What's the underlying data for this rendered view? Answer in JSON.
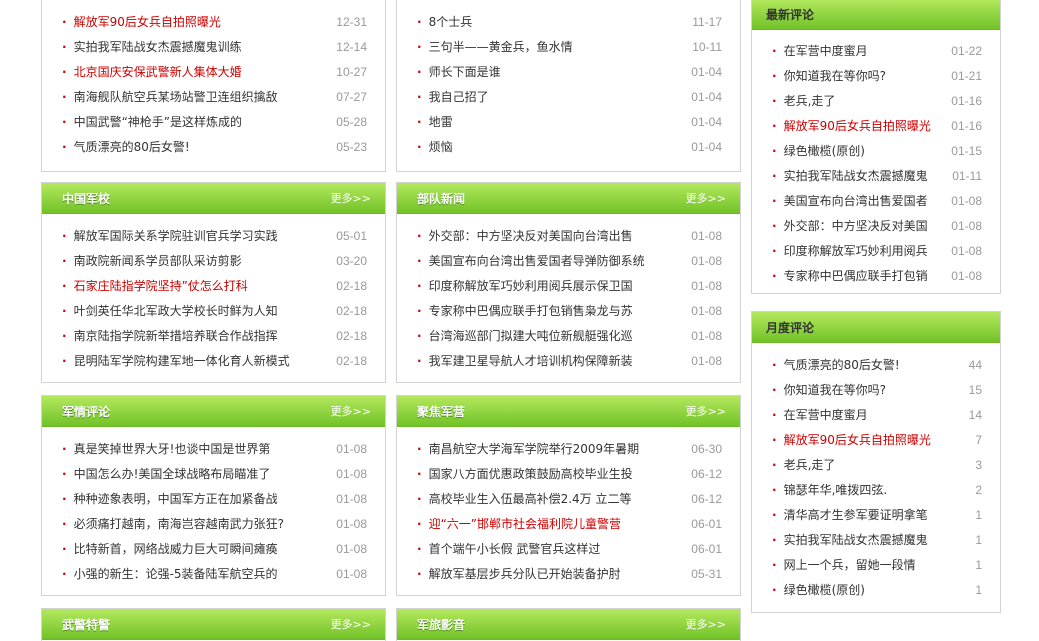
{
  "col1": {
    "top_list": [
      {
        "title": "解放军90后女兵自拍照曝光",
        "date": "12-31",
        "hot": true
      },
      {
        "title": "实拍我军陆战女杰震撼魔鬼训练",
        "date": "12-14",
        "hot": false
      },
      {
        "title": "北京国庆安保武警新人集体大婚",
        "date": "10-27",
        "hot": true
      },
      {
        "title": "南海舰队航空兵某场站警卫连组织擒敌",
        "date": "07-27",
        "hot": false
      },
      {
        "title": "中国武警“神枪手”是这样炼成的",
        "date": "05-28",
        "hot": false
      },
      {
        "title": "气质漂亮的80后女警!",
        "date": "05-23",
        "hot": false
      }
    ],
    "school": {
      "title": "中国军校",
      "more": "更多>>",
      "items": [
        {
          "title": "解放军国际关系学院驻训官兵学习实践",
          "date": "05-01",
          "hot": false
        },
        {
          "title": "南政院新闻系学员部队采访剪影",
          "date": "03-20",
          "hot": false
        },
        {
          "title": "石家庄陆指学院坚持”仗怎么打科",
          "date": "02-18",
          "hot": true
        },
        {
          "title": "叶剑英任华北军政大学校长时鲜为人知",
          "date": "02-18",
          "hot": false
        },
        {
          "title": "南京陆指学院新举措培养联合作战指挥",
          "date": "02-18",
          "hot": false
        },
        {
          "title": "昆明陆军学院构建军地一体化育人新模式",
          "date": "02-18",
          "hot": false
        }
      ]
    },
    "comment": {
      "title": "军情评论",
      "more": "更多>>",
      "items": [
        {
          "title": "真是笑掉世界大牙!也谈中国是世界第",
          "date": "01-08",
          "hot": false
        },
        {
          "title": "中国怎么办!美国全球战略布局瞄准了",
          "date": "01-08",
          "hot": false
        },
        {
          "title": "种种迹象表明，中国军方正在加紧备战",
          "date": "01-08",
          "hot": false
        },
        {
          "title": "必须痛打越南，南海岂容越南武力张狂?",
          "date": "01-08",
          "hot": false
        },
        {
          "title": "比特新首，网络战威力巨大可瞬间瘫痪",
          "date": "01-08",
          "hot": false
        },
        {
          "title": "小强的新生：论强-5装备陆军航空兵的",
          "date": "01-08",
          "hot": false
        }
      ]
    },
    "police": {
      "title": "武警特警",
      "more": "更多>>"
    }
  },
  "col2": {
    "top_list": [
      {
        "title": "8个士兵",
        "date": "11-17",
        "hot": false
      },
      {
        "title": "三句半——黄金兵，鱼水情",
        "date": "10-11",
        "hot": false
      },
      {
        "title": "师长下面是谁",
        "date": "01-04",
        "hot": false
      },
      {
        "title": "我自己招了",
        "date": "01-04",
        "hot": false
      },
      {
        "title": "地雷",
        "date": "01-04",
        "hot": false
      },
      {
        "title": "烦恼",
        "date": "01-04",
        "hot": false
      }
    ],
    "troops": {
      "title": "部队新闻",
      "more": "更多>>",
      "items": [
        {
          "title": "外交部：中方坚决反对美国向台湾出售",
          "date": "01-08",
          "hot": false
        },
        {
          "title": "美国宣布向台湾出售爱国者导弹防御系统",
          "date": "01-08",
          "hot": false
        },
        {
          "title": "印度称解放军巧妙利用阅兵展示保卫国",
          "date": "01-08",
          "hot": false
        },
        {
          "title": "专家称中巴偶应联手打包销售枭龙与苏",
          "date": "01-08",
          "hot": false
        },
        {
          "title": "台湾海巡部门拟建大吨位新舰艇强化巡",
          "date": "01-08",
          "hot": false
        },
        {
          "title": "我军建卫星导航人才培训机构保障新装",
          "date": "01-08",
          "hot": false
        }
      ]
    },
    "focus": {
      "title": "聚焦军营",
      "more": "更多>>",
      "items": [
        {
          "title": "南昌航空大学海军学院举行2009年暑期",
          "date": "06-30",
          "hot": false
        },
        {
          "title": "国家八方面优惠政策鼓励高校毕业生投",
          "date": "06-12",
          "hot": false
        },
        {
          "title": "高校毕业生入伍最高补偿2.4万 立二等",
          "date": "06-12",
          "hot": false
        },
        {
          "title": "迎“六一”邯郸市社会福利院儿童警营",
          "date": "06-01",
          "hot": true
        },
        {
          "title": "首个端午小长假 武警官兵这样过",
          "date": "06-01",
          "hot": false
        },
        {
          "title": "解放军基层步兵分队已开始装备护肘",
          "date": "05-31",
          "hot": false
        }
      ]
    },
    "film": {
      "title": "军旅影音",
      "more": "更多>>"
    }
  },
  "col3": {
    "latest": {
      "title": "最新评论",
      "items": [
        {
          "title": "在军营中度蜜月",
          "date": "01-22",
          "hot": false
        },
        {
          "title": "你知道我在等你吗?",
          "date": "01-21",
          "hot": false
        },
        {
          "title": "老兵,走了",
          "date": "01-16",
          "hot": false
        },
        {
          "title": "解放军90后女兵自拍照曝光",
          "date": "01-16",
          "hot": true
        },
        {
          "title": "绿色橄榄(原创)",
          "date": "01-15",
          "hot": false
        },
        {
          "title": "实拍我军陆战女杰震撼魔鬼",
          "date": "01-11",
          "hot": false
        },
        {
          "title": "美国宣布向台湾出售爱国者",
          "date": "01-08",
          "hot": false
        },
        {
          "title": "外交部：中方坚决反对美国",
          "date": "01-08",
          "hot": false
        },
        {
          "title": "印度称解放军巧妙利用阅兵",
          "date": "01-08",
          "hot": false
        },
        {
          "title": "专家称中巴偶应联手打包销",
          "date": "01-08",
          "hot": false
        }
      ]
    },
    "monthly": {
      "title": "月度评论",
      "items": [
        {
          "title": "气质漂亮的80后女警!",
          "date": "44",
          "hot": false
        },
        {
          "title": "你知道我在等你吗?",
          "date": "15",
          "hot": false
        },
        {
          "title": "在军营中度蜜月",
          "date": "14",
          "hot": false
        },
        {
          "title": "解放军90后女兵自拍照曝光",
          "date": "7",
          "hot": true
        },
        {
          "title": "老兵,走了",
          "date": "3",
          "hot": false
        },
        {
          "title": "锦瑟年华,唯拨四弦.",
          "date": "2",
          "hot": false
        },
        {
          "title": "清华高才生参军要证明拿笔",
          "date": "1",
          "hot": false
        },
        {
          "title": "实拍我军陆战女杰震撼魔鬼",
          "date": "1",
          "hot": false
        },
        {
          "title": "网上一个兵，留她一段情",
          "date": "1",
          "hot": false
        },
        {
          "title": "绿色橄榄(原创)",
          "date": "1",
          "hot": false
        }
      ]
    }
  }
}
